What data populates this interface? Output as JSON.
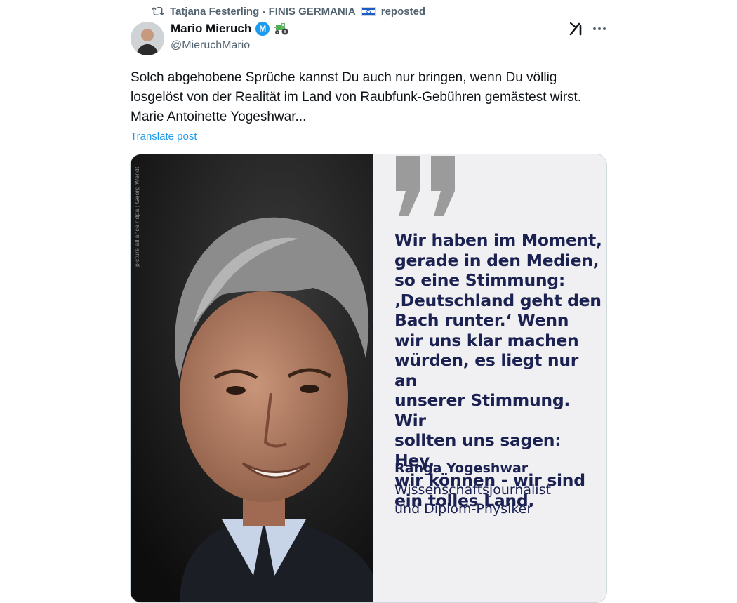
{
  "repost": {
    "icon": "repost-icon",
    "user": "Tatjana Festerling - FINIS GERMANIA",
    "flag": "israel-flag-icon",
    "suffix": "reposted"
  },
  "author": {
    "name": "Mario Mieruch",
    "badge_letter": "M",
    "handle": "@MieruchMario"
  },
  "actions": {
    "grok": "grok-icon",
    "more": "more-icon"
  },
  "post": {
    "text": "Solch abgehobene Sprüche kannst Du auch nur bringen, wenn Du völlig losgelöst von der Realität im Land von Raubfunk-Gebühren gemästest wirst. Marie Antoinette Yogeshwar...",
    "translate_label": "Translate post"
  },
  "media": {
    "photo_credit": "picture alliance / dpa | Georg Wendt",
    "quote": "Wir haben im Moment,\ngerade in den Medien,\nso eine Stimmung:\n‚Deutschland geht den\nBach runter.‘ Wenn\nwir uns klar machen\nwürden, es liegt nur an\nunserer Stimmung. Wir\nsollten uns sagen: Hey,\nwir können - wir sind\nein tolles Land.",
    "quote_author": "Ranga Yogeshwar",
    "quote_role": "Wissenschaftsjournalist\nund Diplom-Physiker"
  },
  "colors": {
    "accent": "#1d9bf0",
    "secondary_text": "#536471",
    "quote_navy": "#1b2252",
    "quote_panel": "#f0f0f2"
  }
}
